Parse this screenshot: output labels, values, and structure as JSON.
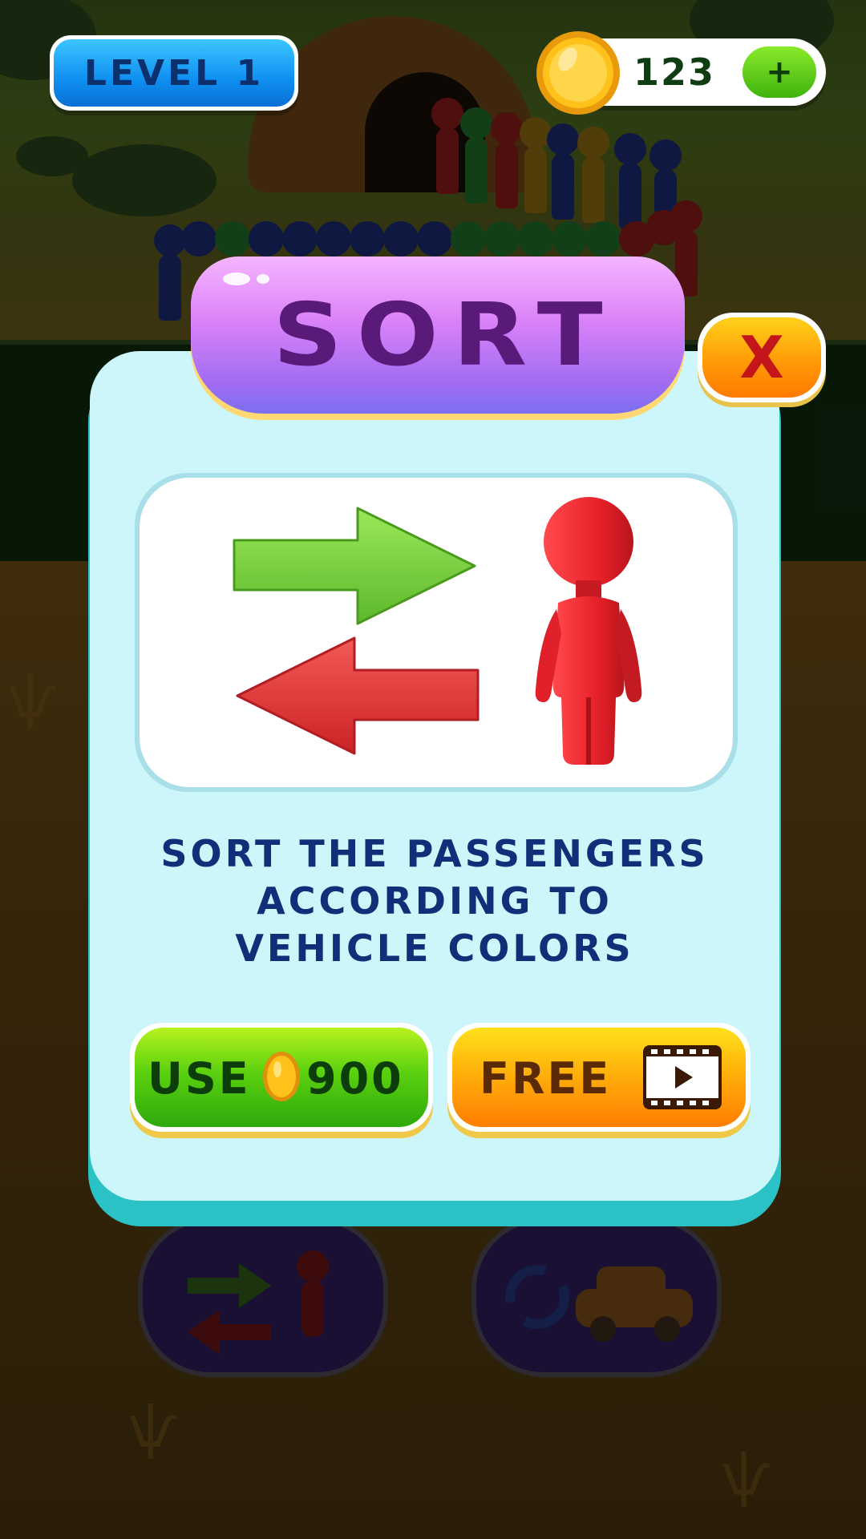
{
  "hud": {
    "level_label": "LEVEL 1",
    "coins": "123",
    "add_coins_symbol": "+"
  },
  "modal": {
    "title": "SORT",
    "close_symbol": "X",
    "description_lines": [
      "SORT THE PASSENGERS",
      "ACCORDING TO",
      "VEHICLE COLORS"
    ],
    "use_button": {
      "label": "USE",
      "price": "900"
    },
    "free_button": {
      "label": "FREE"
    }
  },
  "icons": {
    "level": "level-badge",
    "coin": "gold-coin-icon",
    "add": "plus-icon",
    "close": "close-icon",
    "swap_arrows": "swap-arrows-icon",
    "passenger": "passenger-figure-icon",
    "video": "video-ad-icon",
    "shuffle": "shuffle-icon",
    "car": "car-icon"
  },
  "colors": {
    "level_blue": "#0f8ff0",
    "title_purple": "#db83f8",
    "panel_bg": "#ccf6fa",
    "text_navy": "#0f2f78",
    "use_green": "#5bd10f",
    "free_orange": "#ffac0a",
    "close_orange": "#ff9a07",
    "arrow_green": "#7fd43c",
    "arrow_red": "#e8353a",
    "figure_red": "#e8212a"
  }
}
